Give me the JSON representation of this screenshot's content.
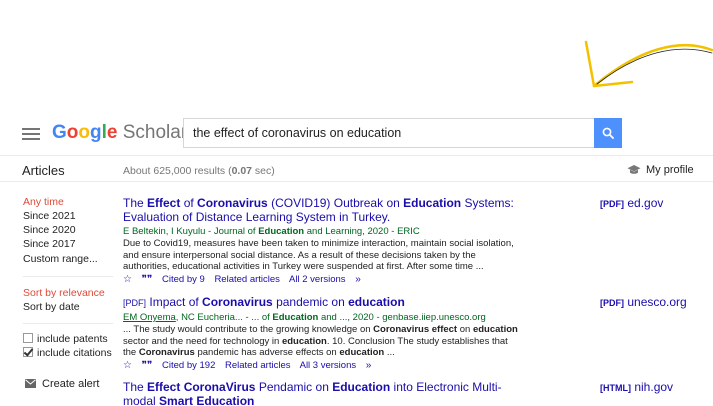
{
  "header": {
    "logo_google": "Google",
    "logo_scholar": "Scholar",
    "search_value": "the effect of coronavirus on education"
  },
  "subheader": {
    "articles": "Articles",
    "results_prefix": "About 625,000 results (",
    "results_time": "0.07",
    "results_suffix": " sec)",
    "my_profile": "My profile"
  },
  "sidebar": {
    "time_items": [
      "Any time",
      "Since 2021",
      "Since 2020",
      "Since 2017",
      "Custom range..."
    ],
    "sort_items": [
      "Sort by relevance",
      "Sort by date"
    ],
    "include_patents": "include patents",
    "include_citations": "include citations",
    "create_alert": "Create alert"
  },
  "results": [
    {
      "title_parts": [
        "The ",
        "Effect",
        " of ",
        "Coronavirus",
        " (COVID19) Outbreak on ",
        "Education",
        " Systems: Evaluation of Distance Learning System in Turkey."
      ],
      "authors": "E Beltekin, I Kuyulu - Journal of ",
      "authors_bold": "Education",
      "authors_end": " and Learning, 2020 - ERIC",
      "snippet": "Due to Covid19, measures have been taken to minimize interaction, maintain social isolation, and ensure interpersonal social distance. As a result of these decisions taken by the authorities, educational activities in Turkey were suspended at first. After some time ...",
      "cited": "Cited by 9",
      "related": "Related articles",
      "versions": "All 2 versions",
      "side_type": "[PDF]",
      "side_domain": "ed.gov"
    },
    {
      "pdf_tag": "[PDF]",
      "title_parts": [
        "Impact of ",
        "Coronavirus",
        " pandemic on ",
        "education"
      ],
      "authors_underlined": "EM Onyema",
      "authors": ", NC Eucheria... - ... of ",
      "authors_bold": "Education",
      "authors_end": " and ..., 2020 - genbase.iiep.unesco.org",
      "snippet_parts": [
        "... The study would contribute to the growing knowledge on ",
        "Coronavirus effect",
        " on ",
        "education",
        " sector and the need for technology in ",
        "education",
        ". 10. Conclusion The study establishes that the ",
        "Coronavirus",
        " pandemic has adverse effects on ",
        "education",
        " ..."
      ],
      "cited": "Cited by 192",
      "related": "Related articles",
      "versions": "All 3 versions",
      "side_type": "[PDF]",
      "side_domain": "unesco.org"
    },
    {
      "title_parts": [
        "The ",
        "Effect CoronaVirus",
        " Pendamic on ",
        "Education",
        " into Electronic Multi-modal ",
        "Smart Education"
      ],
      "side_type": "[HTML]",
      "side_domain": "nih.gov"
    }
  ],
  "colors": {
    "link": "#1a0dab",
    "green": "#006621",
    "active": "#dd4b39",
    "search_button": "#4d90fe",
    "arrow": "#f2c200"
  },
  "icons": [
    "menu-icon",
    "search-icon",
    "graduation-cap-icon",
    "star-icon",
    "quote-icon",
    "more-icon",
    "envelope-icon",
    "arrow-annotation"
  ]
}
